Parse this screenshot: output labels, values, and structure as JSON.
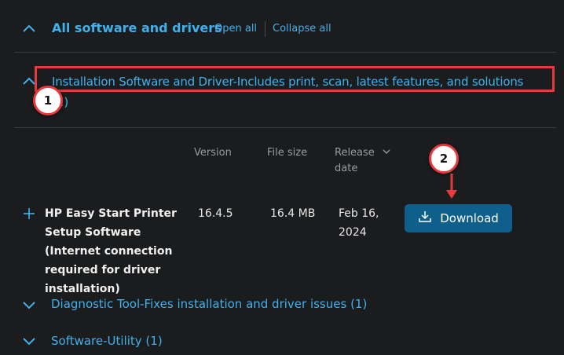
{
  "accordion": {
    "all_title": "All software and drivers",
    "open_all": "Open all",
    "collapse_all": "Collapse all"
  },
  "install_section": {
    "title": "Installation Software and Driver-Includes print, scan, latest features, and solutions",
    "count": "(1)"
  },
  "table": {
    "headers": {
      "version": "Version",
      "file_size": "File size",
      "release_line1": "Release",
      "release_line2": "date"
    },
    "row": {
      "name": "HP Easy Start Printer Setup Software (Internet connection required for driver installation)",
      "version": "16.4.5",
      "size": "16.4 MB",
      "date_line1": "Feb 16,",
      "date_line2": "2024",
      "download_label": "Download"
    }
  },
  "sections": [
    {
      "title": "Diagnostic Tool-Fixes installation and driver issues (1)"
    },
    {
      "title": "Software-Utility (1)"
    }
  ],
  "annotations": {
    "step1": "1",
    "step2": "2"
  },
  "colors": {
    "background": "#1b1c1e",
    "link_blue": "#3fb2ec",
    "button_blue": "#0f5f8c",
    "annotation_red": "#e8393f"
  },
  "icons": [
    "chevron-up-icon",
    "chevron-down-icon",
    "plus-icon",
    "download-icon",
    "sort-chevron-icon"
  ]
}
